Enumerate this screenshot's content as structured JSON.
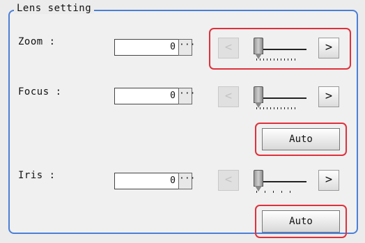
{
  "group": {
    "title": "Lens setting"
  },
  "zoom": {
    "label": "Zoom :",
    "value": "0",
    "dots": "···",
    "prev": "<",
    "next": ">",
    "level": 0
  },
  "focus": {
    "label": "Focus :",
    "value": "0",
    "dots": "···",
    "prev": "<",
    "next": ">",
    "level": 0,
    "auto_label": "Auto"
  },
  "iris": {
    "label": "Iris :",
    "value": "0",
    "dots": "···",
    "prev": "<",
    "next": ">",
    "level": 0,
    "auto_label": "Auto"
  },
  "colors": {
    "group_border": "#4a7fd8",
    "highlight": "#e0303a"
  }
}
